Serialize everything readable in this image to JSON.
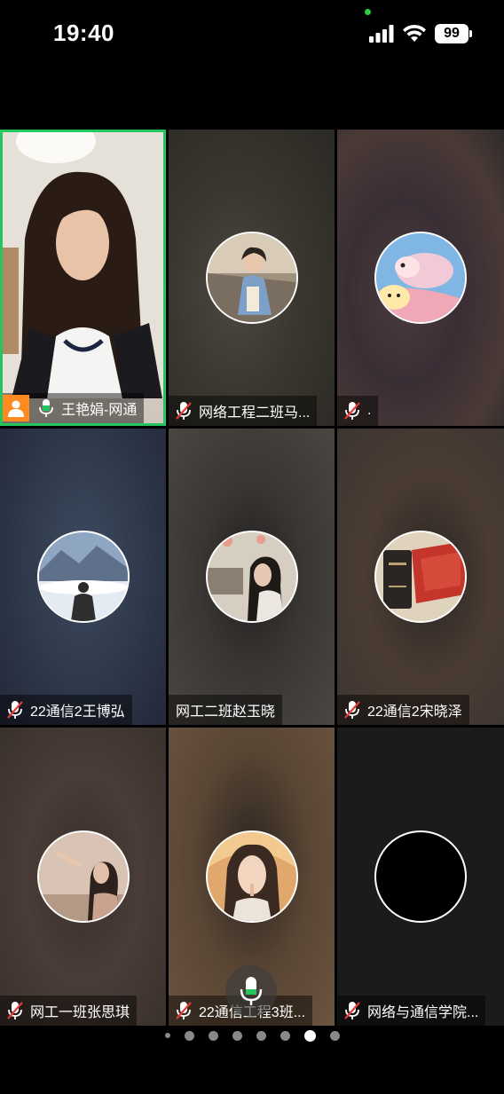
{
  "status": {
    "time": "19:40",
    "battery": "99"
  },
  "participants": [
    {
      "name": "王艳娟-网通",
      "mic": "on",
      "host": true,
      "active_speaker": true
    },
    {
      "name": "网络工程二班马...",
      "mic": "off"
    },
    {
      "name": ".",
      "mic": "off"
    },
    {
      "name": "22通信2王博弘",
      "mic": "off"
    },
    {
      "name": "网工二班赵玉晓",
      "mic": "none"
    },
    {
      "name": "22通信2宋晓泽",
      "mic": "off"
    },
    {
      "name": "网工一班张思琪",
      "mic": "off"
    },
    {
      "name": "22通信工程3班...",
      "mic": "off"
    },
    {
      "name": "网络与通信学院...",
      "mic": "off"
    }
  ],
  "pager": {
    "pages": 8,
    "current_index": 6
  },
  "colors": {
    "active_border": "#22c55e",
    "host_badge": "#ff8a1f",
    "mic_on": "#22c55e"
  }
}
